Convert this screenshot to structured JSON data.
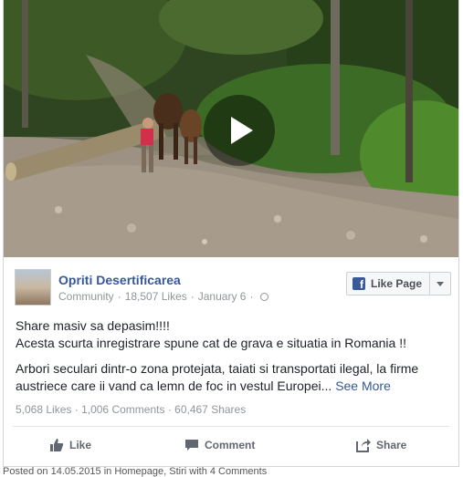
{
  "post": {
    "page_name": "Opriti Desertificarea",
    "category": "Community",
    "likes_count": "18,507 Likes",
    "date": "January 6",
    "like_page_label": "Like Page",
    "text_line1": "Share masiv sa depasim!!!!",
    "text_line2": "Acesta scurta inregistrare spune cat de grava e situatia in Romania !!",
    "text_para2": "Arbori seculari dintr-o zona protejata, taiati si transportati ilegal, la firme austriece care ii vand ca lemn de foc in vestul Europei...",
    "see_more": "See More",
    "stats": {
      "likes": "5,068 Likes",
      "comments": "1,006 Comments",
      "shares": "60,467 Shares"
    },
    "actions": {
      "like": "Like",
      "comment": "Comment",
      "share": "Share"
    }
  },
  "caption": "Posted on 14.05.2015 in Homepage, Stiri with 4 Comments",
  "icons": {
    "play": "play-icon",
    "globe": "globe-icon",
    "facebook": "facebook-icon",
    "like": "thumbs-up-icon",
    "comment": "comment-icon",
    "share": "share-icon"
  }
}
